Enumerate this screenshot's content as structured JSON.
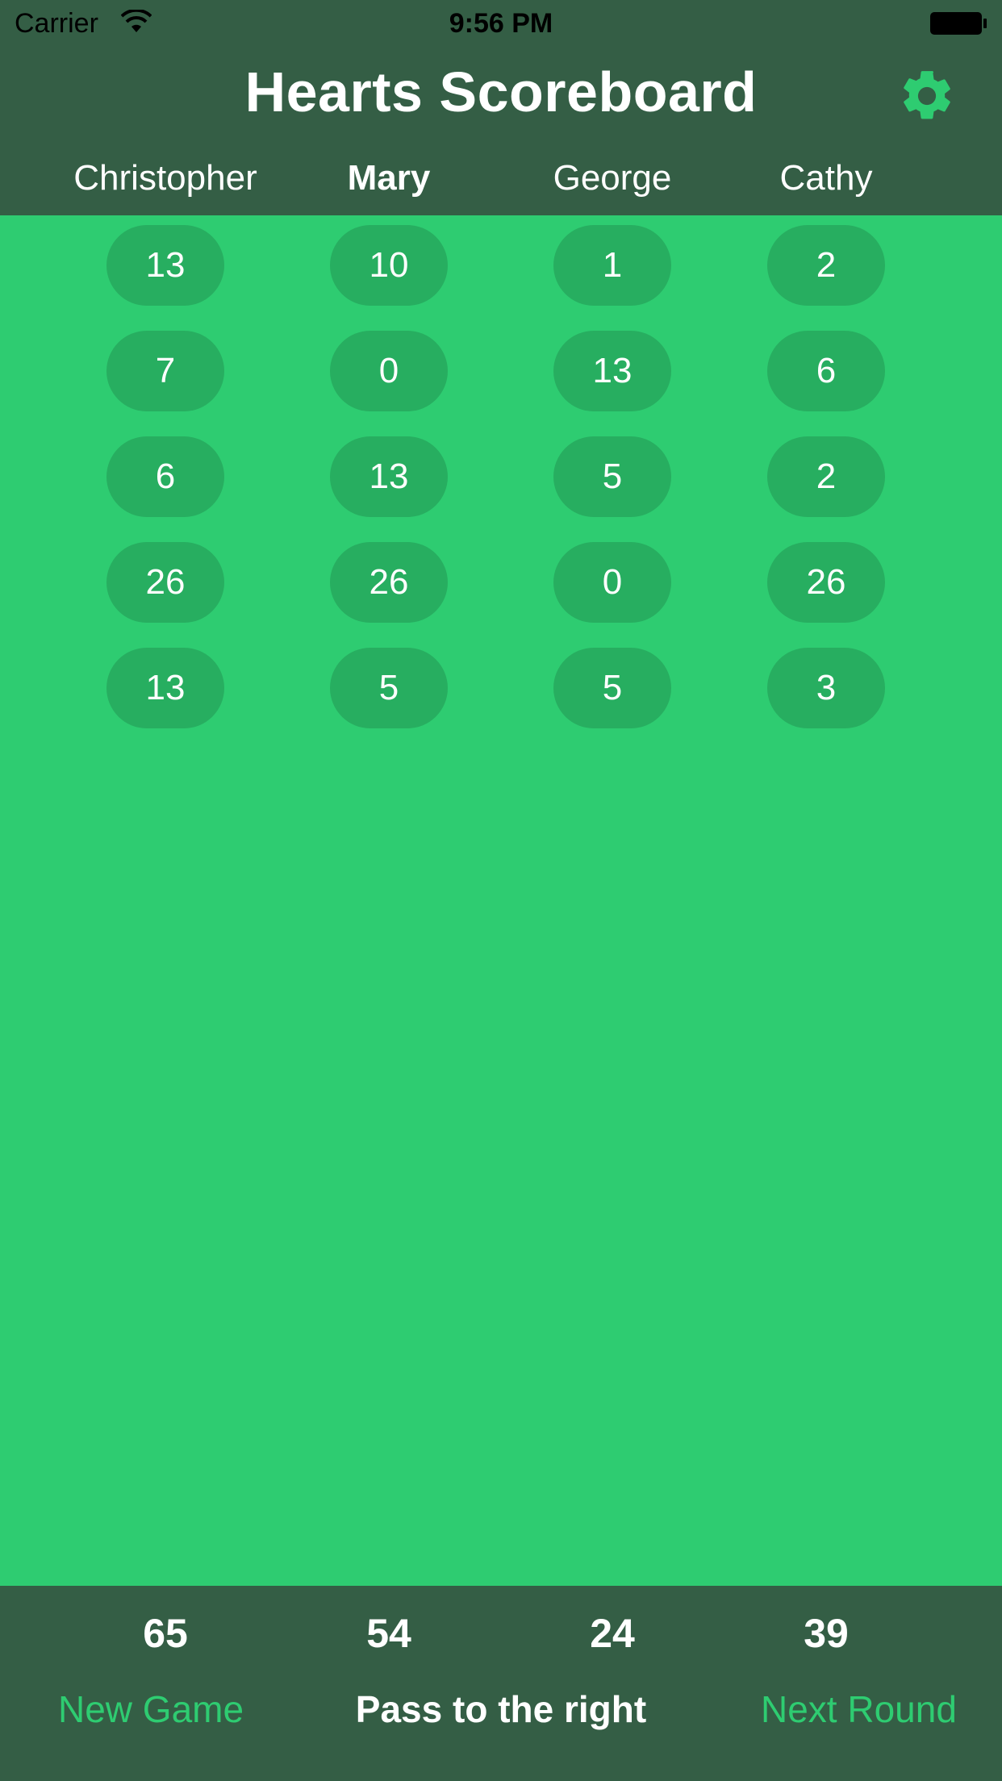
{
  "status_bar": {
    "carrier": "Carrier",
    "time": "9:56 PM",
    "wifi_icon": "wifi-icon",
    "battery_icon": "battery-icon"
  },
  "header": {
    "title": "Hearts Scoreboard",
    "settings_icon": "gear-icon",
    "accent_color": "#2ecc71"
  },
  "players": [
    {
      "name": "Christopher",
      "active": false
    },
    {
      "name": "Mary",
      "active": true
    },
    {
      "name": "George",
      "active": false
    },
    {
      "name": "Cathy",
      "active": false
    }
  ],
  "rounds": [
    [
      "13",
      "10",
      "1",
      "2"
    ],
    [
      "7",
      "0",
      "13",
      "6"
    ],
    [
      "6",
      "13",
      "5",
      "2"
    ],
    [
      "26",
      "26",
      "0",
      "26"
    ],
    [
      "13",
      "5",
      "5",
      "3"
    ]
  ],
  "totals": [
    "65",
    "54",
    "24",
    "39"
  ],
  "footer": {
    "new_game": "New Game",
    "pass_direction": "Pass to the right",
    "next_round": "Next Round"
  },
  "colors": {
    "background": "#2ecc71",
    "bars": "#345e45",
    "pill": "#27ae60"
  }
}
